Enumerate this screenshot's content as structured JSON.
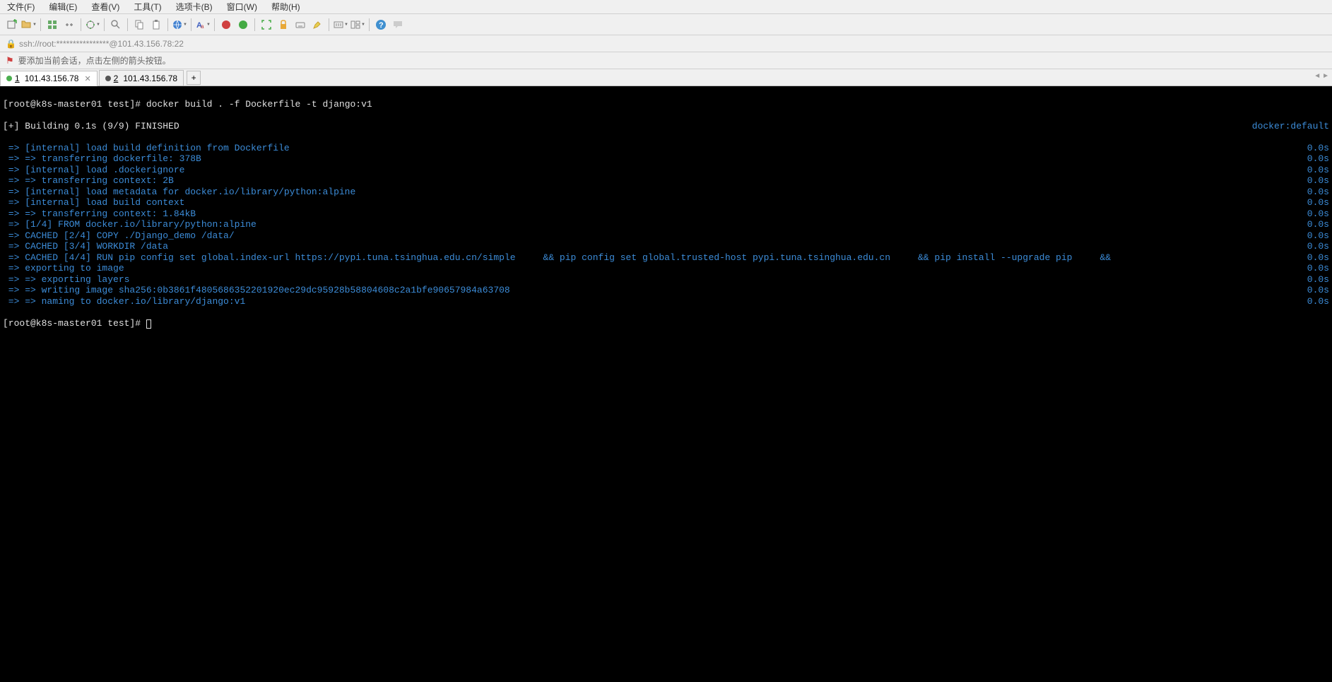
{
  "menu": {
    "items": [
      "文件(F)",
      "编辑(E)",
      "查看(V)",
      "工具(T)",
      "选项卡(B)",
      "窗口(W)",
      "帮助(H)"
    ]
  },
  "address": {
    "url": "ssh://root:****************@101.43.156.78:22"
  },
  "tip": {
    "text": "要添加当前会话，点击左侧的箭头按钮。"
  },
  "tabs": {
    "items": [
      {
        "num": "1",
        "label": "101.43.156.78",
        "active": true,
        "closable": true
      },
      {
        "num": "2",
        "label": "101.43.156.78",
        "active": false,
        "closable": false
      }
    ],
    "add": "+"
  },
  "terminal": {
    "prompt1": "[root@k8s-master01 test]# ",
    "cmd1": "docker build . -f Dockerfile -t django:v1",
    "building_left": "[+] Building 0.1s (9/9) FINISHED",
    "building_right": "docker:default",
    "lines": [
      {
        "left": "=> [internal] load build definition from Dockerfile",
        "right": "0.0s"
      },
      {
        "left": "=> => transferring dockerfile: 378B",
        "right": "0.0s"
      },
      {
        "left": "=> [internal] load .dockerignore",
        "right": "0.0s"
      },
      {
        "left": "=> => transferring context: 2B",
        "right": "0.0s"
      },
      {
        "left": "=> [internal] load metadata for docker.io/library/python:alpine",
        "right": "0.0s"
      },
      {
        "left": "=> [internal] load build context",
        "right": "0.0s"
      },
      {
        "left": "=> => transferring context: 1.84kB",
        "right": "0.0s"
      },
      {
        "left": "=> [1/4] FROM docker.io/library/python:alpine",
        "right": "0.0s"
      },
      {
        "left": "=> CACHED [2/4] COPY ./Django_demo /data/",
        "right": "0.0s"
      },
      {
        "left": "=> CACHED [3/4] WORKDIR /data",
        "right": "0.0s"
      },
      {
        "left": "=> CACHED [4/4] RUN pip config set global.index-url https://pypi.tuna.tsinghua.edu.cn/simple     && pip config set global.trusted-host pypi.tuna.tsinghua.edu.cn     && pip install --upgrade pip     &&",
        "right": "0.0s"
      },
      {
        "left": "=> exporting to image",
        "right": "0.0s"
      },
      {
        "left": "=> => exporting layers",
        "right": "0.0s"
      },
      {
        "left": "=> => writing image sha256:0b3861f4805686352201920ec29dc95928b58804608c2a1bfe90657984a63708",
        "right": "0.0s"
      },
      {
        "left": "=> => naming to docker.io/library/django:v1",
        "right": "0.0s"
      }
    ],
    "prompt2": "[root@k8s-master01 test]# "
  }
}
